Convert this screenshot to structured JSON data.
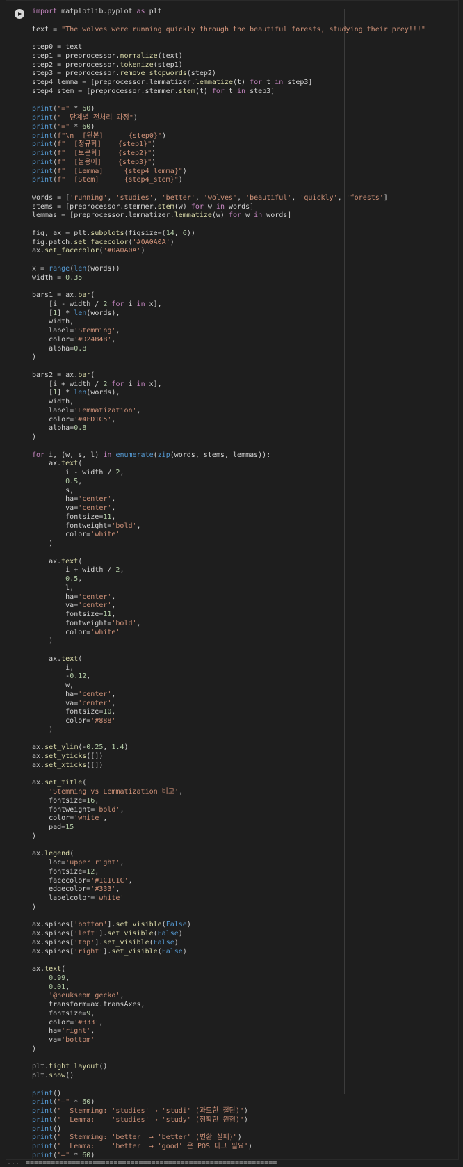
{
  "cell": {
    "run_button_icon": "play-icon",
    "code_lines": [
      "import matplotlib.pyplot as plt",
      "",
      "text = \"The wolves were running quickly through the beautiful forests, studying their prey!!!\"",
      "",
      "step0 = text",
      "step1 = preprocessor.normalize(text)",
      "step2 = preprocessor.tokenize(step1)",
      "step3 = preprocessor.remove_stopwords(step2)",
      "step4_lemma = [preprocessor.lemmatizer.lemmatize(t) for t in step3]",
      "step4_stem = [preprocessor.stemmer.stem(t) for t in step3]",
      "",
      "print(\"=\" * 60)",
      "print(\"  단계별 전처리 과정\")",
      "print(\"=\" * 60)",
      "print(f\"\\n  [원본]      {step0}\")",
      "print(f\"  [정규화]    {step1}\")",
      "print(f\"  [토큰화]    {step2}\")",
      "print(f\"  [불용어]    {step3}\")",
      "print(f\"  [Lemma]     {step4_lemma}\")",
      "print(f\"  [Stem]      {step4_stem}\")",
      "",
      "words = ['running', 'studies', 'better', 'wolves', 'beautiful', 'quickly', 'forests']",
      "stems = [preprocessor.stemmer.stem(w) for w in words]",
      "lemmas = [preprocessor.lemmatizer.lemmatize(w) for w in words]",
      "",
      "fig, ax = plt.subplots(figsize=(14, 6))",
      "fig.patch.set_facecolor('#0A0A0A')",
      "ax.set_facecolor('#0A0A0A')",
      "",
      "x = range(len(words))",
      "width = 0.35",
      "",
      "bars1 = ax.bar(",
      "    [i - width / 2 for i in x],",
      "    [1] * len(words),",
      "    width,",
      "    label='Stemming',",
      "    color='#D24B4B',",
      "    alpha=0.8",
      ")",
      "",
      "bars2 = ax.bar(",
      "    [i + width / 2 for i in x],",
      "    [1] * len(words),",
      "    width,",
      "    label='Lemmatization',",
      "    color='#4FD1C5',",
      "    alpha=0.8",
      ")",
      "",
      "for i, (w, s, l) in enumerate(zip(words, stems, lemmas)):",
      "    ax.text(",
      "        i - width / 2,",
      "        0.5,",
      "        s,",
      "        ha='center',",
      "        va='center',",
      "        fontsize=11,",
      "        fontweight='bold',",
      "        color='white'",
      "    )",
      "",
      "    ax.text(",
      "        i + width / 2,",
      "        0.5,",
      "        l,",
      "        ha='center',",
      "        va='center',",
      "        fontsize=11,",
      "        fontweight='bold',",
      "        color='white'",
      "    )",
      "",
      "    ax.text(",
      "        i,",
      "        -0.12,",
      "        w,",
      "        ha='center',",
      "        va='center',",
      "        fontsize=10,",
      "        color='#888'",
      "    )",
      "",
      "ax.set_ylim(-0.25, 1.4)",
      "ax.set_yticks([])",
      "ax.set_xticks([])",
      "",
      "ax.set_title(",
      "    'Stemming vs Lemmatization 비교',",
      "    fontsize=16,",
      "    fontweight='bold',",
      "    color='white',",
      "    pad=15",
      ")",
      "",
      "ax.legend(",
      "    loc='upper right',",
      "    fontsize=12,",
      "    facecolor='#1C1C1C',",
      "    edgecolor='#333',",
      "    labelcolor='white'",
      ")",
      "",
      "ax.spines['bottom'].set_visible(False)",
      "ax.spines['left'].set_visible(False)",
      "ax.spines['top'].set_visible(False)",
      "ax.spines['right'].set_visible(False)",
      "",
      "ax.text(",
      "    0.99,",
      "    0.01,",
      "    '@heukseom_gecko',",
      "    transform=ax.transAxes,",
      "    fontsize=9,",
      "    color='#333',",
      "    ha='right',",
      "    va='bottom'",
      ")",
      "",
      "plt.tight_layout()",
      "plt.show()",
      "",
      "print()",
      "print(\"—\" * 60)",
      "print(\"  Stemming: 'studies' → 'studi' (과도한 절단)\")",
      "print(\"  Lemma:    'studies' → 'study' (정확한 원형)\")",
      "print()",
      "print(\"  Stemming: 'better' → 'better' (변환 실패)\")",
      "print(\"  Lemma:    'better' → 'good' 은 POS 태그 필요\")",
      "print(\"—\" * 60)"
    ]
  },
  "output": {
    "gutter_label": "...",
    "first_line": "============================================================"
  },
  "colors": {
    "background": "#1e1e1e",
    "keyword": "#c586c0",
    "builtin": "#569cd6",
    "function": "#dcdcaa",
    "string": "#ce9178",
    "number": "#b5cea8"
  }
}
